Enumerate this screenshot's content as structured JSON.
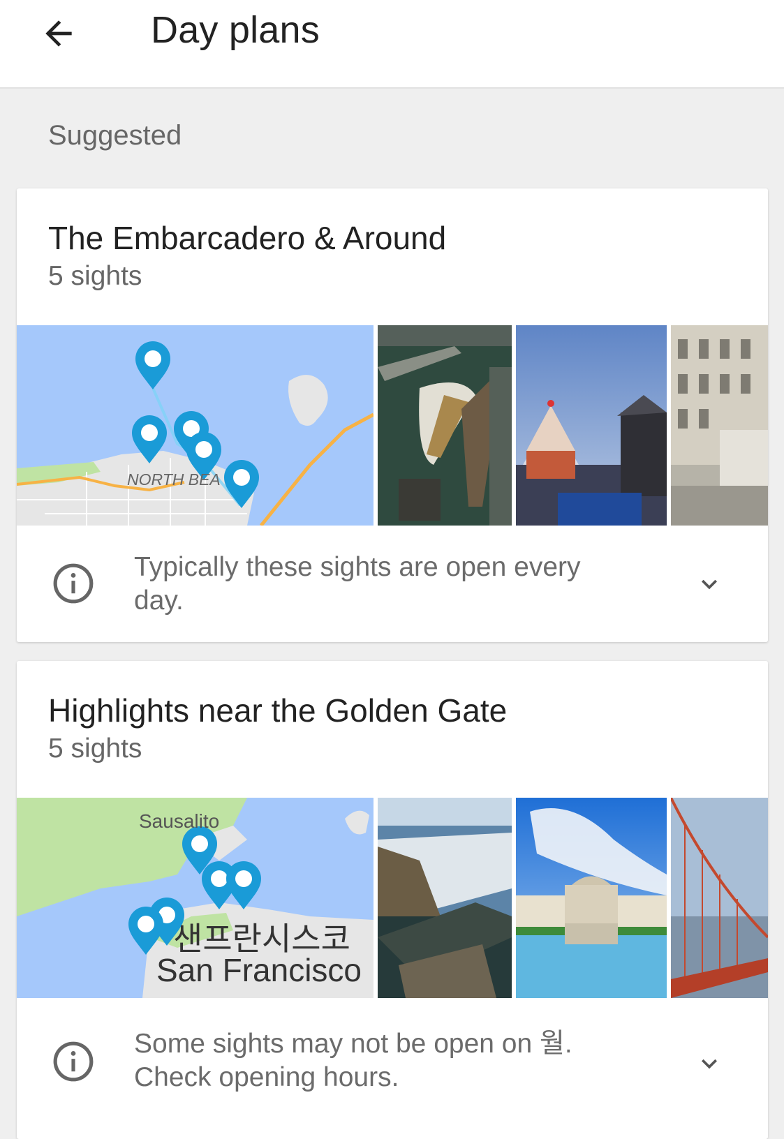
{
  "appbar": {
    "title": "Day plans",
    "back_icon": "arrow-left-icon"
  },
  "section": {
    "label": "Suggested"
  },
  "plans": [
    {
      "title": "The Embarcadero & Around",
      "subtitle": "5 sights",
      "map_label": "NORTH BEA",
      "info_text": "Typically these sights are open every day.",
      "info_icon": "info-icon",
      "expand_icon": "chevron-down-icon"
    },
    {
      "title": "Highlights near the Golden Gate",
      "subtitle": "5 sights",
      "map_label_top": "Sausalito",
      "map_label_kr": "샌프란시스코",
      "map_label_city": "San Francisco",
      "info_text": "Some sights may not be open on 월. Check opening hours.",
      "info_icon": "info-icon",
      "expand_icon": "chevron-down-icon"
    }
  ],
  "colors": {
    "water": "#a5c8fb",
    "land": "#e8e8e8",
    "park": "#bfe3a3",
    "pin": "#1a9bd7",
    "road": "#f7b245"
  }
}
